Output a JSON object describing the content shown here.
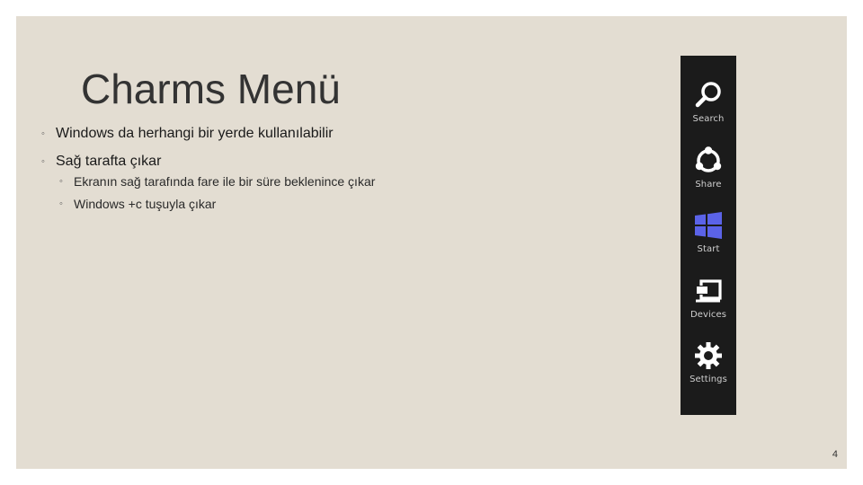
{
  "slide": {
    "title": "Charms Menü",
    "bullets": [
      {
        "text": "Windows da herhangi bir yerde kullanılabilir",
        "children": []
      },
      {
        "text": "Sağ tarafta çıkar",
        "children": [
          "Ekranın sağ tarafında fare ile bir süre beklenince çıkar",
          "Windows +c tuşuyla çıkar"
        ]
      }
    ],
    "bullet_marker": "◦",
    "page_number": "4"
  },
  "charms": {
    "items": [
      {
        "label": "Search",
        "icon": "search-icon"
      },
      {
        "label": "Share",
        "icon": "share-icon"
      },
      {
        "label": "Start",
        "icon": "windows-start-icon"
      },
      {
        "label": "Devices",
        "icon": "devices-icon"
      },
      {
        "label": "Settings",
        "icon": "settings-gear-icon"
      }
    ],
    "colors": {
      "background": "#1b1b1b",
      "icon": "#ffffff",
      "start_icon": "#5b63e8"
    }
  }
}
